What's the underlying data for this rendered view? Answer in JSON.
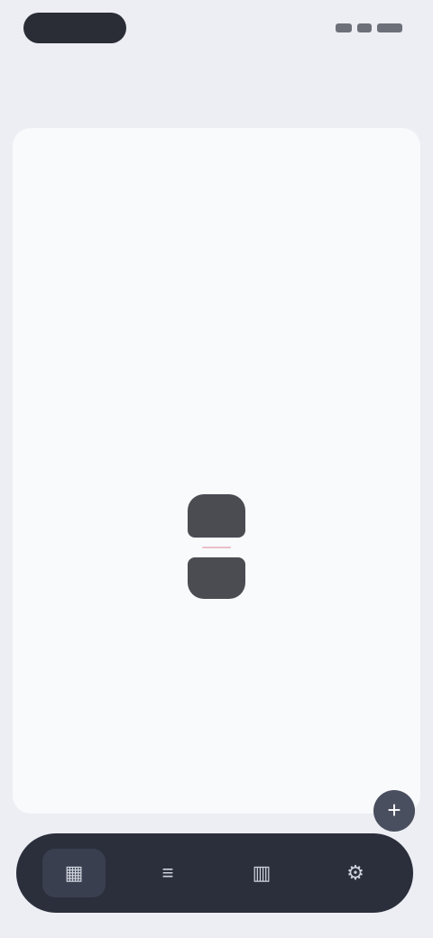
{
  "status": {
    "pill_label": "",
    "icons": [
      "signal-icon",
      "wifi-icon",
      "battery-icon"
    ]
  },
  "header": {
    "month_label": ""
  },
  "calendar": {
    "days": [
      [
        "",
        "",
        "",
        "",
        "",
        "",
        ""
      ],
      [
        "",
        "",
        "",
        "",
        "",
        "",
        ""
      ],
      [
        "",
        "",
        "",
        "",
        "",
        "",
        ""
      ],
      [
        "",
        "",
        "",
        "",
        "",
        "",
        ""
      ],
      [
        "",
        "",
        "",
        "",
        "",
        ""
      ]
    ],
    "selected_day": ""
  },
  "nav": {
    "items": [
      {
        "label": "",
        "icon": "calendar-icon"
      },
      {
        "label": "",
        "icon": "list-icon"
      },
      {
        "label": "",
        "icon": "chart-icon"
      },
      {
        "label": "",
        "icon": "settings-icon"
      }
    ],
    "fab_icon": "plus-icon"
  }
}
